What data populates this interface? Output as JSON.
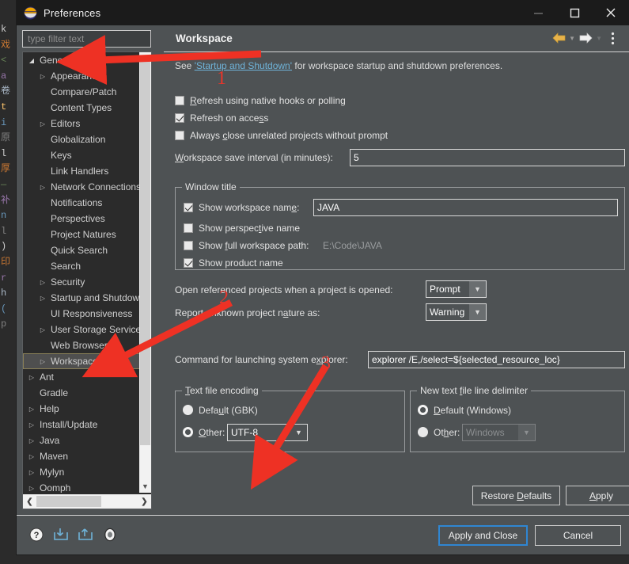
{
  "window": {
    "title": "Preferences",
    "app_icon": "eclipse-icon",
    "minimize": "—",
    "maximize": "□",
    "close": "✕"
  },
  "background_editor": {
    "gutter_chars": [
      "k",
      "戏",
      "<",
      "a",
      "卷",
      "t",
      "i",
      "原",
      "l",
      "厚",
      "—",
      "补",
      "",
      "",
      "n",
      "l",
      ")",
      "印",
      "",
      "r",
      "h",
      "",
      "(",
      "p"
    ]
  },
  "filter": {
    "placeholder": "type filter text",
    "value": ""
  },
  "tree": {
    "items": [
      {
        "label": "General",
        "depth": 0,
        "twisty": "open",
        "selected": false
      },
      {
        "label": "Appearance",
        "depth": 1,
        "twisty": "closed",
        "selected": false
      },
      {
        "label": "Compare/Patch",
        "depth": 1,
        "twisty": "none",
        "selected": false
      },
      {
        "label": "Content Types",
        "depth": 1,
        "twisty": "none",
        "selected": false
      },
      {
        "label": "Editors",
        "depth": 1,
        "twisty": "closed",
        "selected": false
      },
      {
        "label": "Globalization",
        "depth": 1,
        "twisty": "none",
        "selected": false
      },
      {
        "label": "Keys",
        "depth": 1,
        "twisty": "none",
        "selected": false
      },
      {
        "label": "Link Handlers",
        "depth": 1,
        "twisty": "none",
        "selected": false
      },
      {
        "label": "Network Connections",
        "depth": 1,
        "twisty": "closed",
        "selected": false
      },
      {
        "label": "Notifications",
        "depth": 1,
        "twisty": "none",
        "selected": false
      },
      {
        "label": "Perspectives",
        "depth": 1,
        "twisty": "none",
        "selected": false
      },
      {
        "label": "Project Natures",
        "depth": 1,
        "twisty": "none",
        "selected": false
      },
      {
        "label": "Quick Search",
        "depth": 1,
        "twisty": "none",
        "selected": false
      },
      {
        "label": "Search",
        "depth": 1,
        "twisty": "none",
        "selected": false
      },
      {
        "label": "Security",
        "depth": 1,
        "twisty": "closed",
        "selected": false
      },
      {
        "label": "Startup and Shutdown",
        "depth": 1,
        "twisty": "closed",
        "selected": false
      },
      {
        "label": "UI Responsiveness",
        "depth": 1,
        "twisty": "none",
        "selected": false
      },
      {
        "label": "User Storage Service",
        "depth": 1,
        "twisty": "closed",
        "selected": false
      },
      {
        "label": "Web Browser",
        "depth": 1,
        "twisty": "none",
        "selected": false
      },
      {
        "label": "Workspace",
        "depth": 1,
        "twisty": "closed",
        "selected": true
      },
      {
        "label": "Ant",
        "depth": 0,
        "twisty": "closed",
        "selected": false
      },
      {
        "label": "Gradle",
        "depth": 0,
        "twisty": "none",
        "selected": false
      },
      {
        "label": "Help",
        "depth": 0,
        "twisty": "closed",
        "selected": false
      },
      {
        "label": "Install/Update",
        "depth": 0,
        "twisty": "closed",
        "selected": false
      },
      {
        "label": "Java",
        "depth": 0,
        "twisty": "closed",
        "selected": false
      },
      {
        "label": "Maven",
        "depth": 0,
        "twisty": "closed",
        "selected": false
      },
      {
        "label": "Mylyn",
        "depth": 0,
        "twisty": "closed",
        "selected": false
      },
      {
        "label": "Oomph",
        "depth": 0,
        "twisty": "closed",
        "selected": false
      }
    ]
  },
  "page": {
    "title": "Workspace",
    "nav": {
      "back_icon": "back-arrow-icon",
      "back_menu_icon": "chevron-down-icon",
      "forward_icon": "forward-arrow-icon",
      "forward_menu_icon": "chevron-down-icon",
      "menu_icon": "vertical-dots-icon"
    },
    "description": {
      "prefix": "See ",
      "link": "'Startup and Shutdown'",
      "suffix": " for workspace startup and shutdown preferences."
    },
    "checkboxes": [
      {
        "label_pre": "",
        "label_accel": "R",
        "label_post": "efresh using native hooks or polling",
        "checked": false
      },
      {
        "label_pre": "Refresh on acce",
        "label_accel": "s",
        "label_post": "s",
        "checked": true
      },
      {
        "label_pre": "Always ",
        "label_accel": "c",
        "label_post": "lose unrelated projects without prompt",
        "checked": false
      }
    ],
    "save_interval": {
      "label_accel": "W",
      "label_pre": "",
      "label_post": "orkspace save interval (in minutes):",
      "value": "5"
    },
    "window_title_group": {
      "title": "Window title",
      "show_workspace_name": {
        "label_pre": "Show workspace nam",
        "label_accel": "e",
        "label_post": ":",
        "checked": true
      },
      "workspace_name_value": "JAVA",
      "show_perspective_name": {
        "label_pre": "Show perspec",
        "label_accel": "t",
        "label_post": "ive name",
        "checked": false
      },
      "show_full_workspace_path": {
        "label_pre": "Show ",
        "label_accel": "f",
        "label_post": "ull workspace path:",
        "checked": false
      },
      "full_workspace_path_value": "E:\\Code\\JAVA",
      "show_product_name": {
        "label_pre": "Show product name",
        "label_accel": "",
        "label_post": "",
        "checked": true
      }
    },
    "open_referenced": {
      "label": "Open referenced projects when a project is opened:",
      "value": "Prompt"
    },
    "report_nature": {
      "label_pre": "Report unknown project n",
      "label_accel": "a",
      "label_post": "ture as:",
      "value": "Warning"
    },
    "system_explorer": {
      "label_pre": "Command for launching system e",
      "label_accel": "x",
      "label_post": "plorer:",
      "value": "explorer /E,/select=${selected_resource_loc}"
    },
    "text_file_encoding": {
      "title_pre": "",
      "title_accel": "T",
      "title_post": "ext file encoding",
      "default_option": {
        "label_pre": "Defa",
        "label_accel": "u",
        "label_post": "lt (GBK)",
        "selected": false
      },
      "other_option": {
        "label_pre": "",
        "label_accel": "O",
        "label_post": "ther:",
        "selected": true
      },
      "other_value": "UTF-8"
    },
    "line_delimiter": {
      "title_pre": "New text ",
      "title_accel": "f",
      "title_post": "ile line delimiter",
      "default_option": {
        "label_pre": "",
        "label_accel": "D",
        "label_post": "efault (Windows)",
        "selected": true
      },
      "other_option": {
        "label_pre": "Ot",
        "label_accel": "h",
        "label_post": "er:",
        "selected": false
      },
      "other_value": "Windows"
    },
    "restore_defaults": {
      "label_pre": "Restore ",
      "label_accel": "D",
      "label_post": "efaults"
    },
    "apply": {
      "label_pre": "",
      "label_accel": "A",
      "label_post": "pply"
    }
  },
  "footer": {
    "help_icon": "help-question-icon",
    "import_icon": "import-arrow-icon",
    "export_icon": "export-arrow-icon",
    "oomph_icon": "oomph-record-icon",
    "apply_and_close": "Apply and Close",
    "cancel": "Cancel"
  },
  "annotations": {
    "color": "#e8352b",
    "markers": [
      {
        "number": "1"
      },
      {
        "number": "2"
      },
      {
        "number": "3"
      }
    ]
  }
}
